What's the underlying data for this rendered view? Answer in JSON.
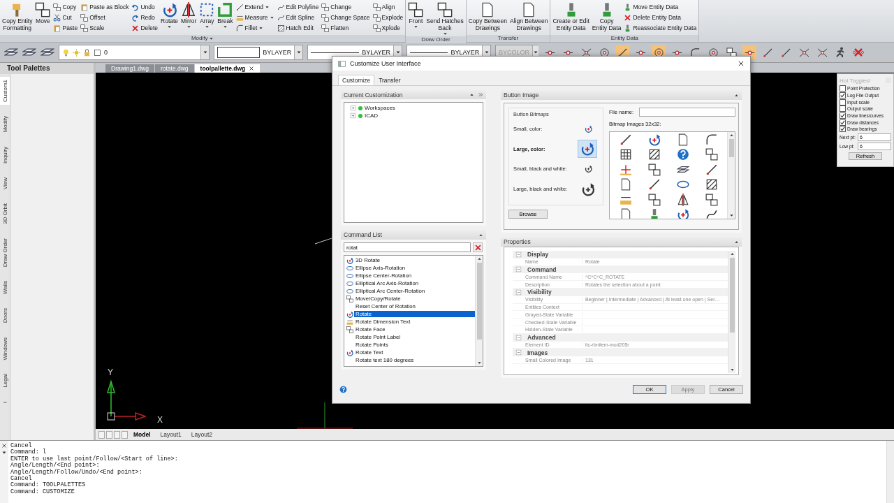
{
  "ribbon": {
    "groups": [
      {
        "label": "Modify",
        "columns": [
          [
            {
              "label": "Copy Entity\nFormatting",
              "kind": "large",
              "dropdown": false
            }
          ],
          [
            {
              "label": "Move",
              "kind": "large",
              "dropdown": false
            }
          ],
          [
            {
              "label": "Copy",
              "kind": "small",
              "dropdown": false
            },
            {
              "label": "Cut",
              "kind": "small",
              "dropdown": false
            },
            {
              "label": "Paste",
              "kind": "small",
              "dropdown": false
            }
          ],
          [
            {
              "label": "Paste as Block",
              "kind": "small",
              "dropdown": false
            },
            {
              "label": "Offset",
              "kind": "small",
              "dropdown": false
            },
            {
              "label": "Scale",
              "kind": "small",
              "dropdown": false
            }
          ],
          [
            {
              "label": "Undo",
              "kind": "small",
              "dropdown": false
            },
            {
              "label": "Redo",
              "kind": "small",
              "dropdown": false
            },
            {
              "label": "Delete",
              "kind": "small",
              "dropdown": false
            }
          ],
          [
            {
              "label": "Rotate",
              "kind": "large",
              "dropdown": true
            }
          ],
          [
            {
              "label": "Mirror",
              "kind": "large",
              "dropdown": true
            }
          ],
          [
            {
              "label": "Array",
              "kind": "large",
              "dropdown": true
            }
          ],
          [
            {
              "label": "Break",
              "kind": "large",
              "dropdown": true
            }
          ],
          [
            {
              "label": "Extend",
              "kind": "small",
              "dropdown": true
            },
            {
              "label": "Measure",
              "kind": "small",
              "dropdown": true
            },
            {
              "label": "Fillet",
              "kind": "small",
              "dropdown": true
            }
          ],
          [
            {
              "label": "Edit Polyline",
              "kind": "small",
              "dropdown": false
            },
            {
              "label": "Edit Spline",
              "kind": "small",
              "dropdown": false
            },
            {
              "label": "Hatch Edit",
              "kind": "small",
              "dropdown": false
            }
          ],
          [
            {
              "label": "Change",
              "kind": "small",
              "dropdown": false
            },
            {
              "label": "Change Space",
              "kind": "small",
              "dropdown": false
            },
            {
              "label": "Flatten",
              "kind": "small",
              "dropdown": false
            }
          ],
          [
            {
              "label": "Align",
              "kind": "small",
              "dropdown": false
            },
            {
              "label": "Explode",
              "kind": "small",
              "dropdown": false
            },
            {
              "label": "Xplode",
              "kind": "small",
              "dropdown": false
            }
          ]
        ]
      },
      {
        "label": "Draw Order",
        "columns": [
          [
            {
              "label": "Front",
              "kind": "large",
              "dropdown": true
            }
          ],
          [
            {
              "label": "Send Hatches\nBack",
              "kind": "large",
              "dropdown": true
            }
          ]
        ]
      },
      {
        "label": "Transfer",
        "columns": [
          [
            {
              "label": "Copy Between\nDrawings",
              "kind": "large",
              "dropdown": false
            }
          ],
          [
            {
              "label": "Align Between\nDrawings",
              "kind": "large",
              "dropdown": false
            }
          ]
        ]
      },
      {
        "label": "Entity Data",
        "columns": [
          [
            {
              "label": "Create or Edit\nEntity Data",
              "kind": "large",
              "dropdown": false
            }
          ],
          [
            {
              "label": "Copy\nEntity Data",
              "kind": "large",
              "dropdown": false
            }
          ],
          [
            {
              "label": "Move Entity Data",
              "kind": "small",
              "dropdown": false
            },
            {
              "label": "Delete Entity Data",
              "kind": "small",
              "dropdown": false
            },
            {
              "label": "Reassociate Entity Data",
              "kind": "small",
              "dropdown": false
            }
          ]
        ]
      }
    ]
  },
  "toolbar": {
    "layer": "0",
    "color_setting": "BYLAYER",
    "linetype": "BYLAYER",
    "lineweight": "BYLAYER",
    "plot_style": {
      "value": "BYCOLOR",
      "disabled": true
    },
    "snaps": [
      {
        "on": false
      },
      {
        "on": false
      },
      {
        "on": false
      },
      {
        "on": false
      },
      {
        "on": true
      },
      {
        "on": false
      },
      {
        "on": true
      },
      {
        "on": false
      },
      {
        "on": false
      },
      {
        "on": false
      },
      {
        "on": false
      },
      {
        "on": true
      },
      {
        "on": false
      },
      {
        "on": false
      },
      {
        "on": false
      },
      {
        "on": false
      }
    ]
  },
  "palette": {
    "title": "Tool Palettes",
    "tabs": [
      {
        "label": "Custom1",
        "selected": true
      },
      {
        "label": "Modify",
        "selected": false
      },
      {
        "label": "Inquiry",
        "selected": false
      },
      {
        "label": "View",
        "selected": false
      },
      {
        "label": "3D Orbit",
        "selected": false
      },
      {
        "label": "Draw Order",
        "selected": false
      },
      {
        "label": "Walls",
        "selected": false
      },
      {
        "label": "Doors",
        "selected": false
      },
      {
        "label": "Windows",
        "selected": false
      },
      {
        "label": "Legal",
        "selected": false
      },
      {
        "label": "!",
        "selected": false
      }
    ]
  },
  "document_tabs": [
    {
      "label": "Drawing1.dwg",
      "selected": false
    },
    {
      "label": "rotate.dwg",
      "selected": false
    },
    {
      "label": "toolpallette.dwg",
      "selected": true
    }
  ],
  "ucs": {
    "y_label": "Y",
    "x_label": "X"
  },
  "layout_tabs": [
    {
      "label": "Model",
      "selected": true
    },
    {
      "label": "Layout1",
      "selected": false
    },
    {
      "label": "Layout2",
      "selected": false
    }
  ],
  "dialog": {
    "title": "Customize User Interface",
    "tabs": [
      {
        "label": "Customize",
        "selected": true
      },
      {
        "label": "Transfer",
        "selected": false
      }
    ],
    "current_customization": {
      "title": "Current Customization",
      "tree": [
        {
          "label": "Workspaces",
          "expanded": false
        },
        {
          "label": "ICAD",
          "expanded": false
        }
      ]
    },
    "command_list": {
      "title": "Command List",
      "search": "rotat",
      "items": [
        {
          "label": "3D Rotate",
          "selected": false
        },
        {
          "label": "Ellipse Axis-Rotation",
          "selected": false
        },
        {
          "label": "Ellipse Center-Rotation",
          "selected": false
        },
        {
          "label": "Elliptical Arc Axis-Rotation",
          "selected": false
        },
        {
          "label": "Elliptical Arc Center-Rotation",
          "selected": false
        },
        {
          "label": "Move/Copy/Rotate",
          "selected": false
        },
        {
          "label": "Reset Center of Rotation",
          "selected": false
        },
        {
          "label": "Rotate",
          "selected": true
        },
        {
          "label": "Rotate Dimension Text",
          "selected": false
        },
        {
          "label": "Rotate Face",
          "selected": false
        },
        {
          "label": "Rotate Point Label",
          "selected": false
        },
        {
          "label": "Rotate Points",
          "selected": false
        },
        {
          "label": "Rotate Text",
          "selected": false
        },
        {
          "label": "Rotate text 180 degrees",
          "selected": false
        }
      ]
    },
    "button_image": {
      "title": "Button Image",
      "group_title": "Button Bitmaps",
      "bitmaps": [
        {
          "label": "Small, color:",
          "selected": false
        },
        {
          "label": "Large, color:",
          "selected": true
        },
        {
          "label": "Small, black and white:",
          "selected": false
        },
        {
          "label": "Large, black and white:",
          "selected": false
        }
      ],
      "file_name_label": "File name:",
      "bitmap_images_label": "Bitmap Images 32x32:",
      "browse": "Browse"
    },
    "properties": {
      "title": "Properties",
      "categories": [
        {
          "name": "Display",
          "expanded": true,
          "rows": [
            {
              "name": "Name",
              "value": "Rotate"
            }
          ]
        },
        {
          "name": "Command",
          "expanded": true,
          "rows": [
            {
              "name": "Command Name",
              "value": "^C^C^C_ROTATE"
            },
            {
              "name": "Description",
              "value": "Rotates the selection about a point"
            }
          ]
        },
        {
          "name": "Visibility",
          "expanded": true,
          "rows": [
            {
              "name": "Visibility",
              "value": "Beginner | Intermediate | Advanced | At least one open | Ser…"
            },
            {
              "name": "Entities Context"
            },
            {
              "name": "Grayed-State Variable"
            },
            {
              "name": "Checked-State Variable"
            },
            {
              "name": "Hidden-State Variable"
            }
          ]
        },
        {
          "name": "Advanced",
          "expanded": true,
          "rows": [
            {
              "name": "Element ID",
              "value": "itc-rbnitem-mod205r"
            }
          ]
        },
        {
          "name": "Images",
          "expanded": true,
          "rows": [
            {
              "name": "Small Colored Image",
              "value": "131"
            }
          ]
        }
      ]
    },
    "buttons": [
      {
        "label": "OK",
        "disabled": false
      },
      {
        "label": "Apply",
        "disabled": true
      },
      {
        "label": "Cancel",
        "disabled": false
      }
    ]
  },
  "hot_toggles": {
    "title": "Hot Toggles!",
    "options": [
      {
        "label": "Point Protection",
        "checked": false
      },
      {
        "label": "Log File Output",
        "checked": true
      },
      {
        "label": "Input scale",
        "checked": false
      },
      {
        "label": "Output scale",
        "checked": false
      },
      {
        "label": "Draw lines/curves",
        "checked": true
      },
      {
        "label": "Draw distances",
        "checked": true
      },
      {
        "label": "Draw bearings",
        "checked": true
      }
    ],
    "fields": [
      {
        "label": "Next pt:",
        "value": "6"
      },
      {
        "label": "Low pt:",
        "value": "6"
      }
    ],
    "refresh": "Refresh"
  },
  "command_history": [
    "Cancel",
    "Command: l",
    "ENTER to use last point/Follow/<Start of line>:",
    "Angle/Length/<End point>:",
    "Angle/Length/Follow/Undo/<End point>:",
    "Cancel",
    "Command: TOOLPALETTES",
    "Command: CUSTOMIZE"
  ]
}
